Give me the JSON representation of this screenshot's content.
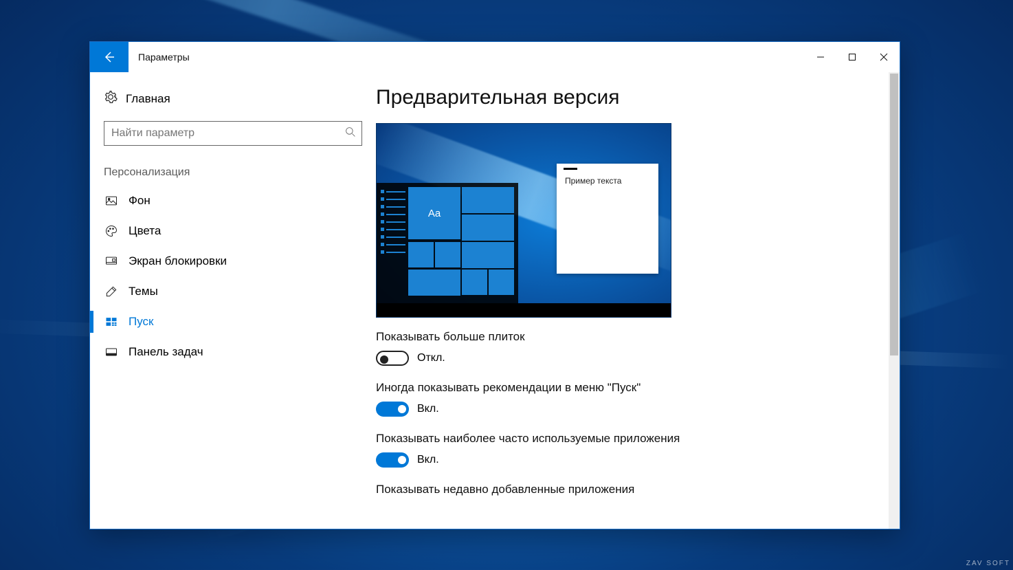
{
  "window": {
    "title": "Параметры"
  },
  "sidebar": {
    "home": "Главная",
    "search_placeholder": "Найти параметр",
    "category": "Персонализация",
    "items": [
      {
        "id": "background",
        "label": "Фон"
      },
      {
        "id": "colors",
        "label": "Цвета"
      },
      {
        "id": "lockscreen",
        "label": "Экран блокировки"
      },
      {
        "id": "themes",
        "label": "Темы"
      },
      {
        "id": "start",
        "label": "Пуск",
        "active": true
      },
      {
        "id": "taskbar",
        "label": "Панель задач"
      }
    ]
  },
  "main": {
    "title": "Предварительная версия",
    "preview_sample_text": "Пример текста",
    "preview_tile_text": "Aa",
    "settings": [
      {
        "id": "more_tiles",
        "label": "Показывать больше плиток",
        "on": false
      },
      {
        "id": "recommend",
        "label": "Иногда показывать рекомендации в меню \"Пуск\"",
        "on": true
      },
      {
        "id": "most_used",
        "label": "Показывать наиболее часто используемые приложения",
        "on": true
      },
      {
        "id": "recent_add",
        "label": "Показывать недавно добавленные приложения"
      }
    ],
    "state_on": "Вкл.",
    "state_off": "Откл."
  },
  "watermark": "ZAV SOFT",
  "colors": {
    "accent": "#0078d7"
  }
}
